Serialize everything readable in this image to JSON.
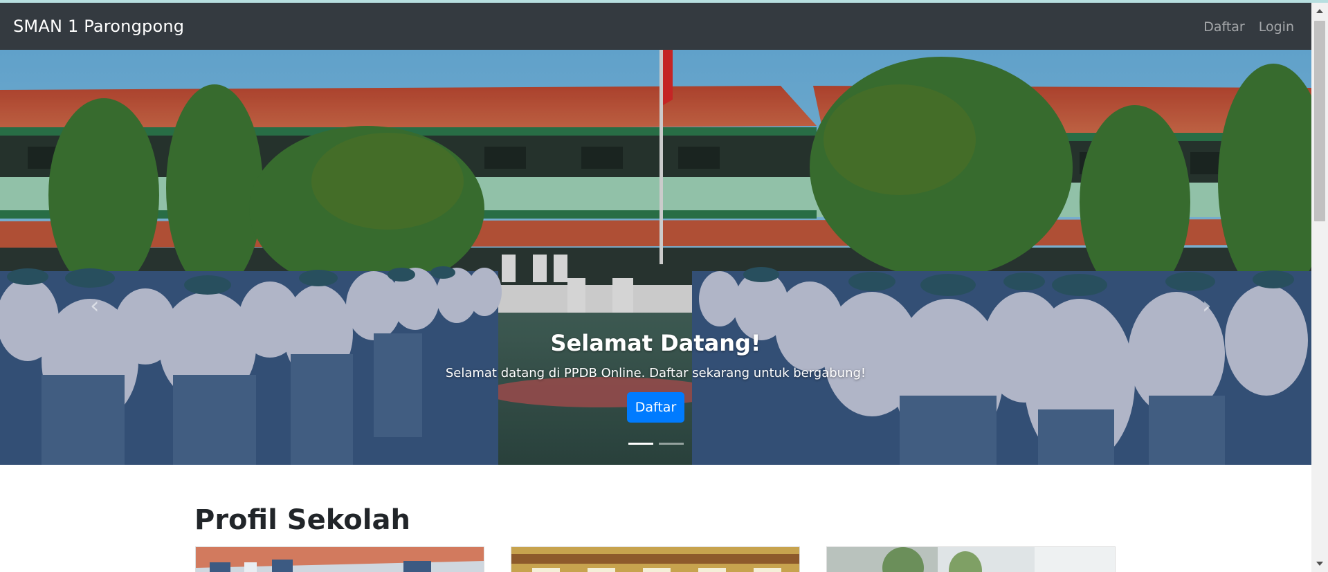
{
  "navbar": {
    "brand": "SMAN 1 Parongpong",
    "links": [
      {
        "label": "Daftar"
      },
      {
        "label": "Login"
      }
    ]
  },
  "carousel": {
    "title": "Selamat Datang!",
    "text": "Selamat datang di PPDB Online. Daftar sekarang untuk bergabung!",
    "button_label": "Daftar",
    "prev_glyph": "‹",
    "next_glyph": "›",
    "indicator_count": 2,
    "active_index": 0
  },
  "profil": {
    "title": "Profil Sekolah"
  },
  "colors": {
    "navbar_bg": "#343a40",
    "primary": "#007bff",
    "roof": "#c7553a",
    "uniform": "#c9cfe3",
    "skirt": "#4a6a93"
  },
  "icons": {
    "scroll_up": "triangle-up-icon",
    "scroll_down": "triangle-down-icon",
    "prev": "chevron-left-icon",
    "next": "chevron-right-icon"
  }
}
